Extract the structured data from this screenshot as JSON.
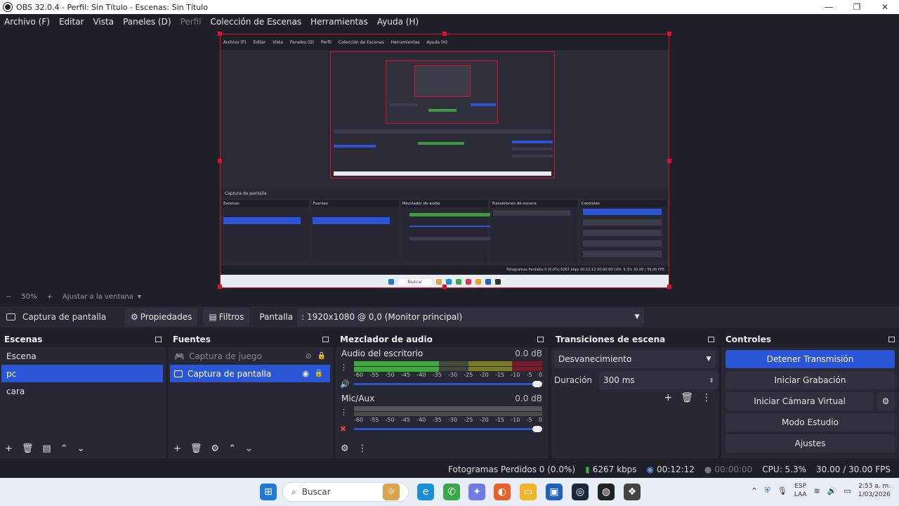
{
  "window": {
    "title": "OBS 32.0.4 - Perfil: Sin Título - Escenas: Sin Título",
    "minimize": "—",
    "maximize": "❐",
    "close": "✕"
  },
  "menu": [
    "Archivo (F)",
    "Editar",
    "Vista",
    "Paneles (D)",
    "Perfil",
    "Colección de Escenas",
    "Herramientas",
    "Ayuda (H)"
  ],
  "zoom": {
    "minus": "−",
    "level": "50%",
    "plus": "+",
    "fit": "Ajustar a la ventana",
    "dropdown": "▾"
  },
  "sourcebar": {
    "source_name": "Captura de pantalla",
    "properties": "Propiedades",
    "filters": "Filtros",
    "display_label": "Pantalla",
    "display_value": ": 1920x1080 @ 0,0 (Monitor principal)"
  },
  "scenes": {
    "title": "Escenas",
    "items": [
      "Escena",
      "pc",
      "cara"
    ],
    "selected": "pc"
  },
  "sources": {
    "title": "Fuentes",
    "items": [
      {
        "name": "Captura de juego",
        "visible": false
      },
      {
        "name": "Captura de pantalla",
        "visible": true
      }
    ]
  },
  "mixer": {
    "title": "Mezclador de audio",
    "channels": [
      {
        "name": "Audio del escritorio",
        "db": "0.0 dB",
        "level": 0.45
      },
      {
        "name": "Mic/Aux",
        "db": "0.0 dB",
        "level": 0.0
      }
    ],
    "ticks": [
      "-60",
      "-55",
      "-50",
      "-45",
      "-40",
      "-35",
      "-30",
      "-25",
      "-20",
      "-15",
      "-10",
      "-5",
      "0"
    ]
  },
  "transitions": {
    "title": "Transiciones de escena",
    "selected": "Desvanecimiento",
    "duration_label": "Duración",
    "duration_value": "300 ms"
  },
  "controls": {
    "title": "Controles",
    "stop_stream": "Detener Transmisión",
    "start_recording": "Iniciar Grabación",
    "start_virtual_cam": "Iniciar Cámara Virtual",
    "studio_mode": "Modo Estudio",
    "settings": "Ajustes"
  },
  "status": {
    "dropped": "Fotogramas Perdidos 0 (0.0%)",
    "bitrate": "6267 kbps",
    "stream_time": "00:12:12",
    "rec_time": "00:00:00",
    "cpu": "CPU: 5.3%",
    "fps": "30.00 / 30.00 FPS"
  },
  "taskbar": {
    "search": "Buscar",
    "lang": "ESP",
    "region": "LAA",
    "time": "2:53 a. m.",
    "date": "1/03/2026"
  },
  "nested": {
    "menu": [
      "Archivo (F)",
      "Editar",
      "Vista",
      "Paneles (D)",
      "Perfil",
      "Colección de Escenas",
      "Herramientas",
      "Ayuda (H)"
    ],
    "sourcebar": "Captura de pantalla",
    "dock_titles": [
      "Escenas",
      "Fuentes",
      "Mezclador de audio",
      "Transiciones de escena",
      "Controles"
    ],
    "status": "Fotogramas Perdidos 0 (0.0%)  6267 kbps  00:12:12  00:00:00  CPU: 5.3%  30.00 / 30.00 FPS",
    "search": "Buscar"
  },
  "colors": {
    "accent": "#2a55d6",
    "selection_border": "#e0102a",
    "bg": "#1e1f29",
    "panel": "#272833"
  }
}
